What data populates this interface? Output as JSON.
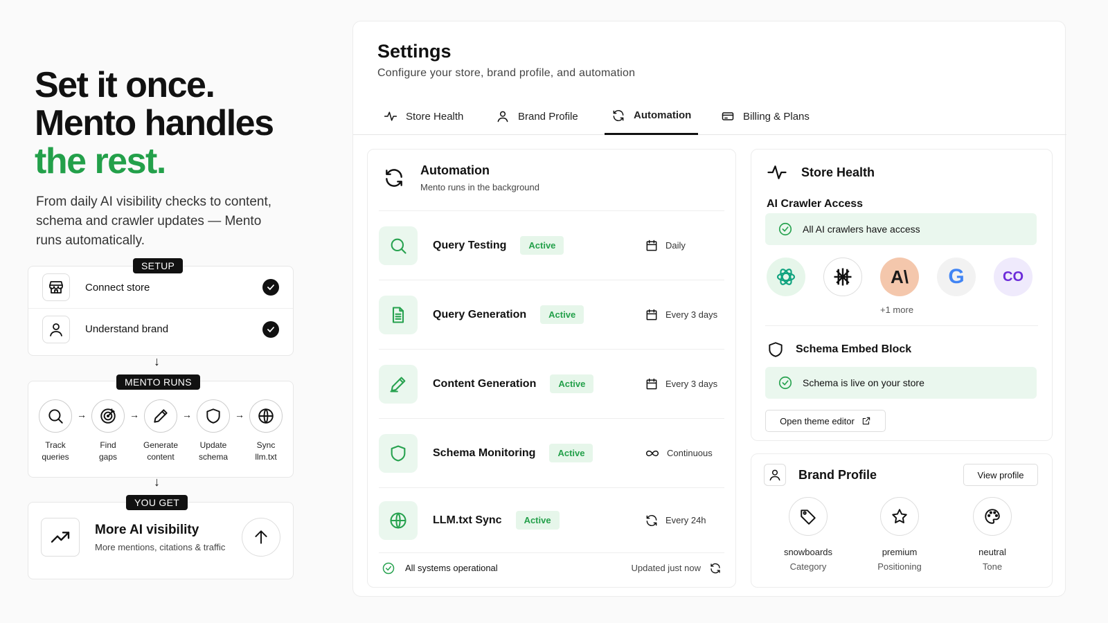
{
  "hero": {
    "line1": "Set it once.",
    "line2": "Mento handles",
    "line3": "the rest.",
    "accent": "#23a04a"
  },
  "subtitle": "From daily AI visibility checks to content, schema and crawler updates — Mento runs automatically.",
  "setup": {
    "tag": "SETUP",
    "steps": [
      {
        "label": "Connect store",
        "icon": "store-icon"
      },
      {
        "label": "Understand brand",
        "icon": "user-icon"
      }
    ]
  },
  "runs": {
    "tag": "MENTO RUNS",
    "nodes": [
      {
        "l1": "Track",
        "l2": "queries",
        "icon": "search-icon"
      },
      {
        "l1": "Find",
        "l2": "gaps",
        "icon": "target-icon"
      },
      {
        "l1": "Generate",
        "l2": "content",
        "icon": "pencil-icon"
      },
      {
        "l1": "Update",
        "l2": "schema",
        "icon": "shield-icon"
      },
      {
        "l1": "Sync",
        "l2": "llm.txt",
        "icon": "globe-icon"
      }
    ]
  },
  "get": {
    "tag": "YOU GET",
    "title": "More AI visibility",
    "sub": "More mentions, citations & traffic"
  },
  "settings": {
    "title": "Settings",
    "subtitle": "Configure your store, brand profile, and automation",
    "tabs": [
      "Store Health",
      "Brand Profile",
      "Automation",
      "Billing & Plans"
    ],
    "active_tab": "Automation"
  },
  "automation": {
    "title": "Automation",
    "sub": "Mento runs in the background",
    "tasks": [
      {
        "name": "Query Testing",
        "status": "Active",
        "schedule": "Daily",
        "icon": "search-icon",
        "sched_icon": "calendar-icon"
      },
      {
        "name": "Query Generation",
        "status": "Active",
        "schedule": "Every 3 days",
        "icon": "document-icon",
        "sched_icon": "calendar-icon"
      },
      {
        "name": "Content Generation",
        "status": "Active",
        "schedule": "Every 3 days",
        "icon": "pencil-icon",
        "sched_icon": "calendar-icon"
      },
      {
        "name": "Schema Monitoring",
        "status": "Active",
        "schedule": "Continuous",
        "icon": "shield-icon",
        "sched_icon": "infinity-icon"
      },
      {
        "name": "LLM.txt Sync",
        "status": "Active",
        "schedule": "Every 24h",
        "icon": "globe-icon",
        "sched_icon": "refresh-icon"
      }
    ],
    "footer_status": "All systems operational",
    "footer_updated": "Updated just now"
  },
  "store_health": {
    "title": "Store Health",
    "crawler_heading": "AI Crawler Access",
    "crawler_status": "All AI crawlers have access",
    "logos": [
      {
        "name": "openai-logo",
        "text": ""
      },
      {
        "name": "perplexity-logo",
        "text": ""
      },
      {
        "name": "anthropic-logo",
        "text": "A\\"
      },
      {
        "name": "google-logo",
        "text": "G"
      },
      {
        "name": "cohere-logo",
        "text": "CO"
      }
    ],
    "more": "+1 more",
    "schema_heading": "Schema Embed Block",
    "schema_status": "Schema is live on your store",
    "theme_button": "Open theme editor"
  },
  "brand_profile": {
    "title": "Brand Profile",
    "view_button": "View profile",
    "attrs": [
      {
        "value": "snowboards",
        "label": "Category",
        "icon": "tag-icon"
      },
      {
        "value": "premium",
        "label": "Positioning",
        "icon": "star-icon"
      },
      {
        "value": "neutral",
        "label": "Tone",
        "icon": "palette-icon"
      }
    ]
  }
}
